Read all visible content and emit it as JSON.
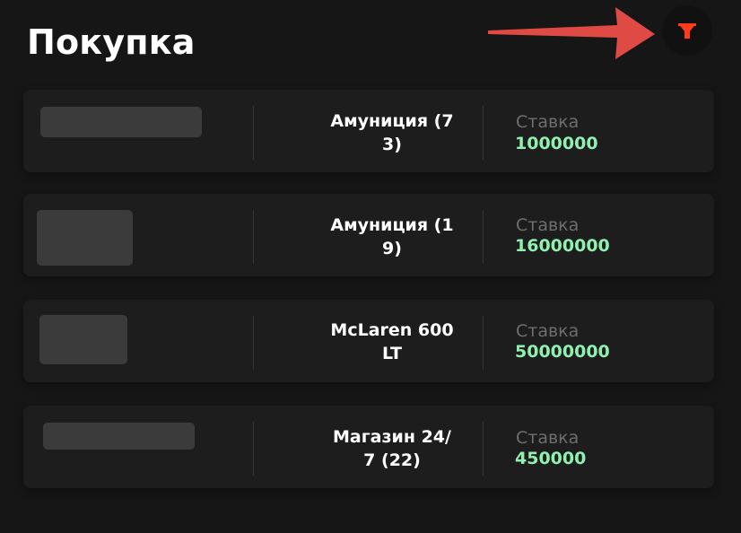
{
  "header": {
    "title": "Покупка",
    "filter_icon": "funnel-icon",
    "accent_color": "#ff3b1a"
  },
  "annotation": {
    "arrow_color": "#e04a45"
  },
  "listings": [
    {
      "name": "Амуниция (7\n3)",
      "bid_label": "Ставка",
      "bid_value": "1000000"
    },
    {
      "name": "Амуниция (1\n9)",
      "bid_label": "Ставка",
      "bid_value": "16000000"
    },
    {
      "name": "McLaren 600\nLT",
      "bid_label": "Ставка",
      "bid_value": "50000000"
    },
    {
      "name": "Магазин 24/\n7 (22)",
      "bid_label": "Ставка",
      "bid_value": "450000"
    }
  ],
  "colors": {
    "background": "#161616",
    "card": "#1d1d1d",
    "bid_value": "#8ff0b0",
    "bid_label": "#6e6e6e"
  }
}
